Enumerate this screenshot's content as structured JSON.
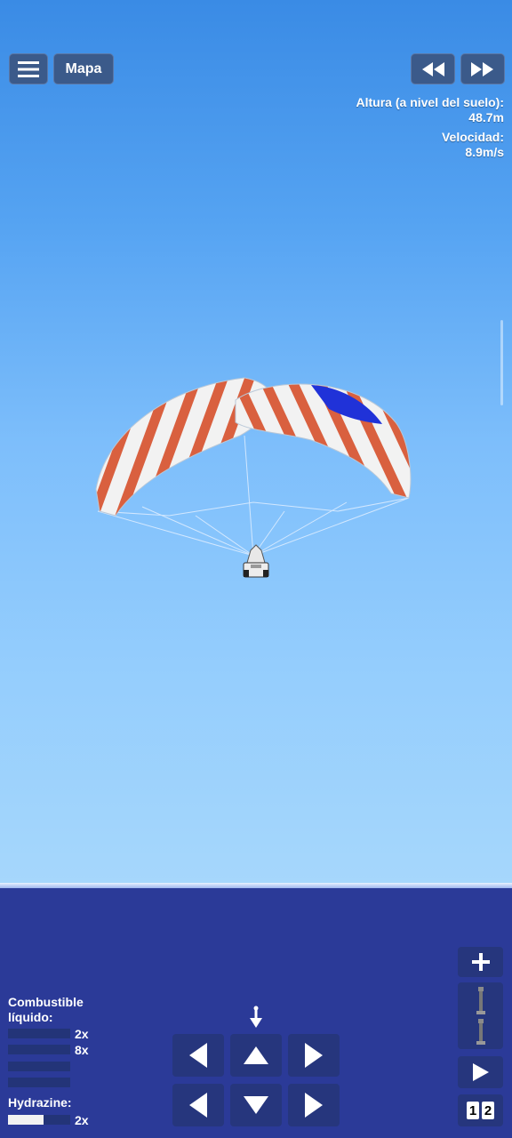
{
  "hud": {
    "map_label": "Mapa",
    "altitude_label": "Altura (a nivel del suelo):",
    "altitude_value": "48.7m",
    "velocity_label": "Velocidad:",
    "velocity_value": "8.9m/s"
  },
  "fuel": {
    "liquid_label_line1": "Combustible",
    "liquid_label_line2": "líquido:",
    "bars": [
      {
        "multiplier": "2x",
        "level": 0
      },
      {
        "multiplier": "8x",
        "level": 0
      },
      {
        "multiplier": "",
        "level": 0
      },
      {
        "multiplier": "",
        "level": 0
      }
    ],
    "hydrazine_label": "Hydrazine:",
    "hydrazine_multiplier": "2x",
    "hydrazine_level": 0.57
  },
  "stage_toggle": {
    "left": "1",
    "right": "2"
  },
  "colors": {
    "button": "#2e4a7e",
    "control_button": "#26367d",
    "sea": "#2b3a98",
    "parachute_red": "#d9603f",
    "parachute_blue": "#2032d8"
  },
  "icons": {
    "menu": "hamburger-icon",
    "rewind": "rewind-icon",
    "fast_forward": "fast-forward-icon",
    "zoom": "plus-icon",
    "play": "play-icon",
    "direction": "direction-arrow-icon"
  }
}
